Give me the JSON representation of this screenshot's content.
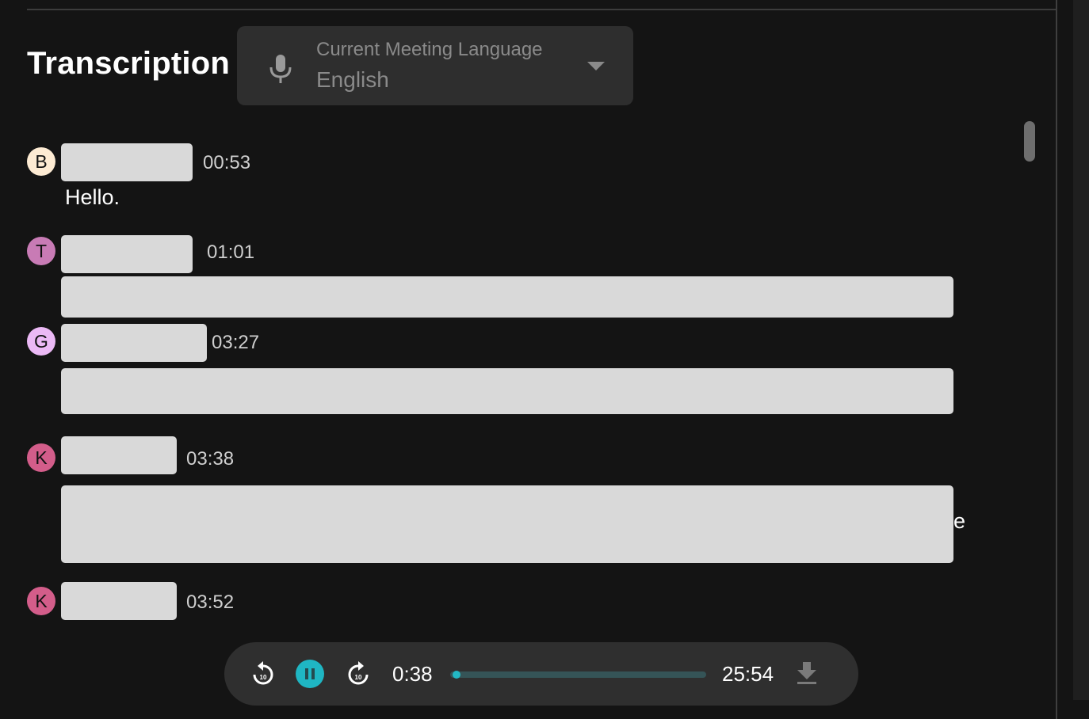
{
  "header": {
    "title": "Transcription",
    "language_select": {
      "label": "Current Meeting Language",
      "value": "English",
      "icon": "microphone-icon"
    }
  },
  "transcript": {
    "entries": [
      {
        "avatar_letter": "B",
        "avatar_color": "#fdebd3",
        "name_redacted": true,
        "timestamp": "00:53",
        "text": "Hello."
      },
      {
        "avatar_letter": "T",
        "avatar_color": "#c87bb5",
        "name_redacted": true,
        "timestamp": "01:01",
        "text_redacted": true
      },
      {
        "avatar_letter": "G",
        "avatar_color": "#ebb9f5",
        "name_redacted": true,
        "timestamp": "03:27",
        "text_redacted": true
      },
      {
        "avatar_letter": "K",
        "avatar_color": "#d35d8a",
        "name_redacted": true,
        "timestamp": "03:38",
        "text_redacted": true,
        "visible_fragment": "e"
      },
      {
        "avatar_letter": "K",
        "avatar_color": "#d35d8a",
        "name_redacted": true,
        "timestamp": "03:52"
      }
    ]
  },
  "player": {
    "current_time": "0:38",
    "total_time": "25:54",
    "progress_fraction": 0.024,
    "state": "playing",
    "rewind_label": "10",
    "forward_label": "10",
    "accent_color": "#1fb6c3"
  }
}
